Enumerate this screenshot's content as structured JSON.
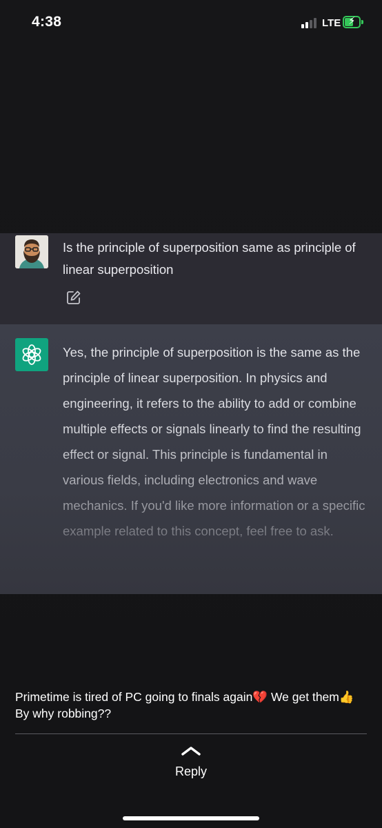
{
  "status_bar": {
    "time": "4:38",
    "network": "LTE",
    "battery_charging": true,
    "signal_bars_filled": 2,
    "signal_bars_total": 4
  },
  "chat": {
    "user_message": "Is the principle of superposition same as principle of linear superposition",
    "assistant_message": "Yes, the principle of superposition is the same as the principle of linear superposition. In physics and engineering, it refers to the ability to add or combine multiple effects or signals linearly to find the resulting effect or signal. This principle is fundamental in various fields, including electronics and wave mechanics. If you'd like more information or a specific example related to this concept, feel free to ask.",
    "colors": {
      "user_bg": "#2c2b33",
      "assistant_bg": "#3d3f4a",
      "assistant_icon_bg": "#10a37f"
    }
  },
  "post": {
    "caption": "Primetime is tired of PC going to finals again💔 We get them👍By why robbing??",
    "reply_label": "Reply"
  },
  "icons": [
    "user-avatar",
    "edit-icon",
    "chatgpt-logo-icon",
    "chevron-up-icon"
  ]
}
